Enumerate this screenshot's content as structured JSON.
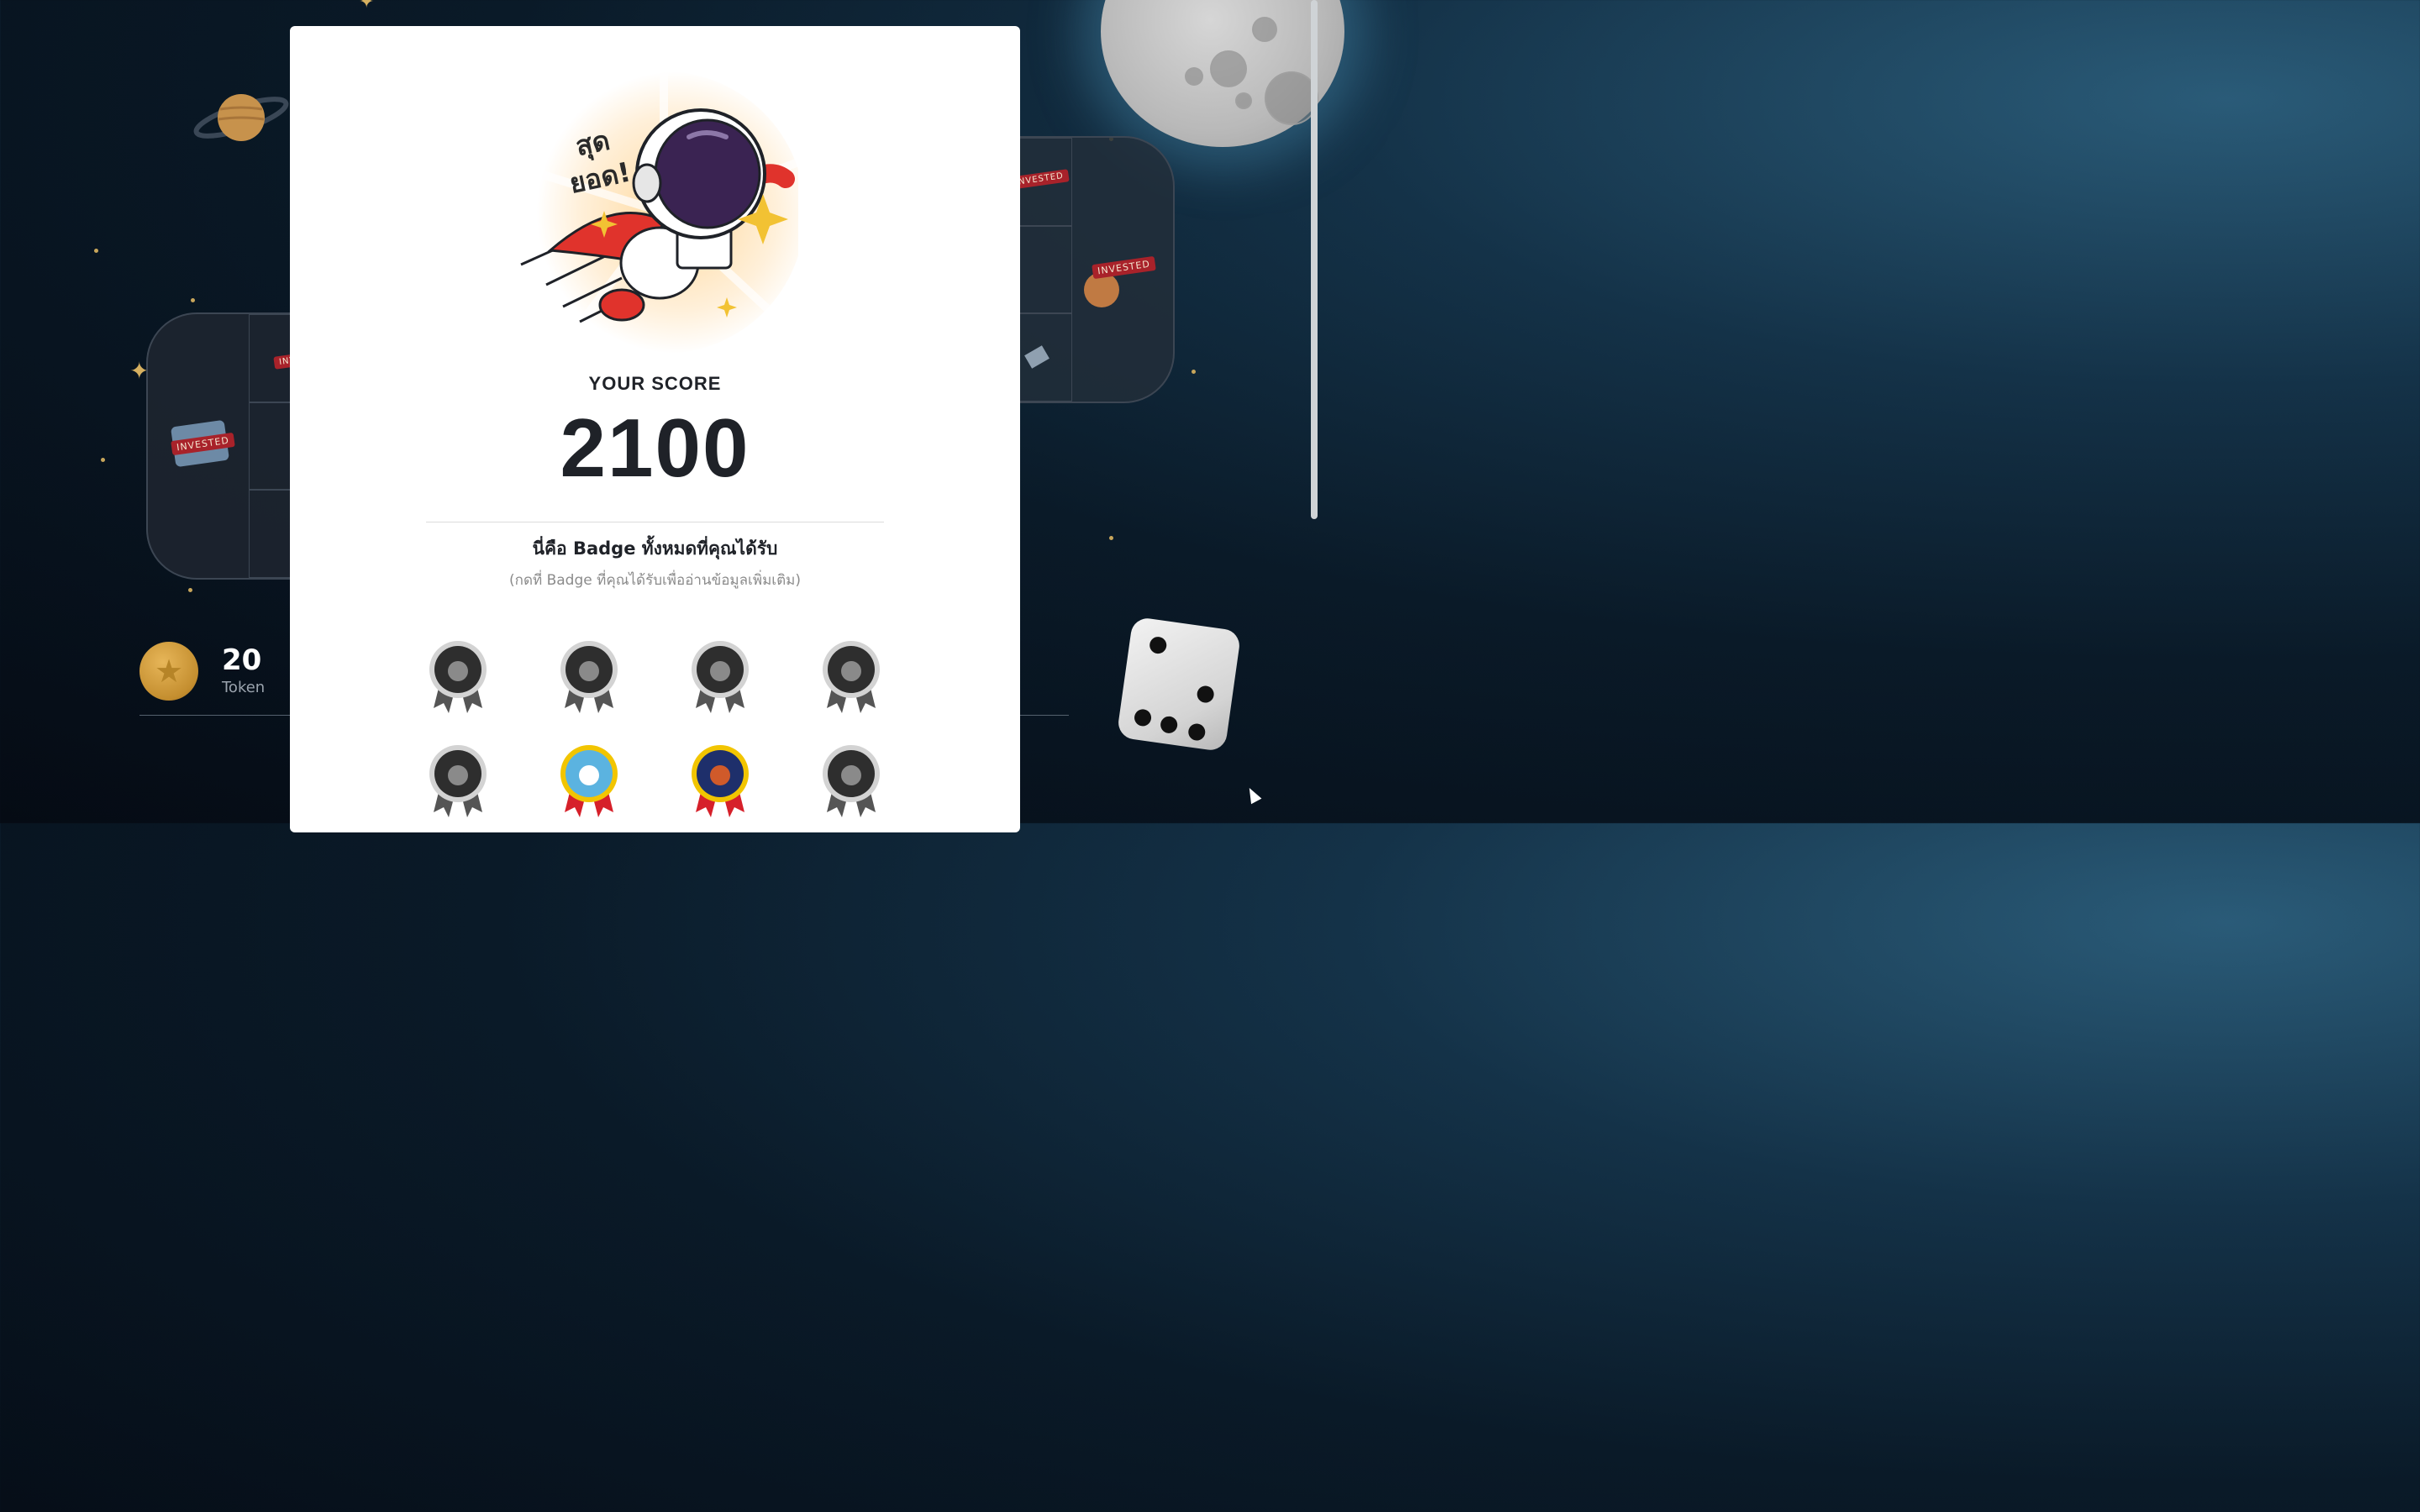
{
  "background": {
    "invested_label": "INVESTED"
  },
  "token": {
    "count": "20",
    "label": "Token",
    "icon": "star-coin-icon"
  },
  "modal": {
    "hero_caption_line1": "สุด",
    "hero_caption_line2": "ยอด!",
    "score_label": "YOUR SCORE",
    "score_value": "2100",
    "badges_title": "นี่คือ Badge ทั้งหมดที่คุณได้รับ",
    "badges_subtitle": "(กดที่ Badge ที่คุณได้รับเพื่ออ่านข้อมูลเพิ่มเติม)",
    "badges": [
      {
        "name": "galaxy-badge",
        "earned": false
      },
      {
        "name": "board-badge",
        "earned": false
      },
      {
        "name": "shield-badge",
        "earned": false
      },
      {
        "name": "observatory-badge",
        "earned": false
      },
      {
        "name": "explosion-badge",
        "earned": false
      },
      {
        "name": "station-badge",
        "earned": true
      },
      {
        "name": "mars-badge",
        "earned": true
      },
      {
        "name": "satellite-badge",
        "earned": false
      }
    ]
  },
  "colors": {
    "modal_bg": "#ffffff",
    "text_dark": "#1f2228",
    "text_muted": "#8b8b8b",
    "gold": "#c8a65b",
    "ribbon_red": "#d6202a",
    "ribbon_gray": "#555555"
  }
}
